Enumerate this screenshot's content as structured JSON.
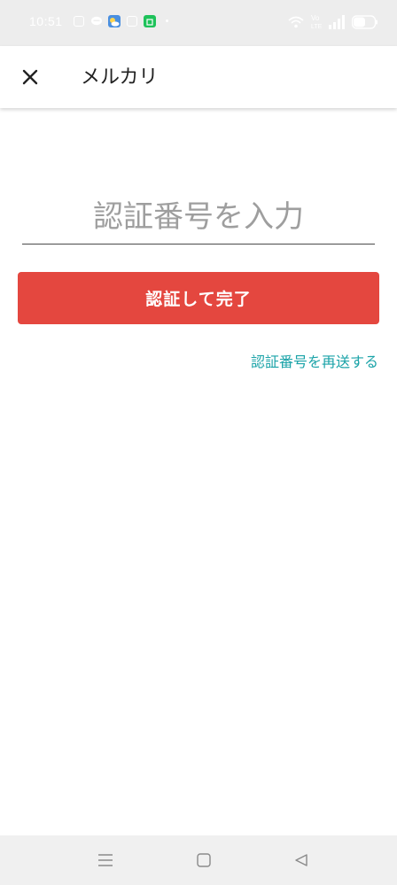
{
  "status_bar": {
    "time": "10:51",
    "icons": [
      "instagram-icon",
      "chat-icon",
      "weather-icon",
      "instagram-icon",
      "calendar-icon",
      "wifi-icon",
      "volte-icon",
      "signal-icon",
      "battery-icon"
    ],
    "volte_label": "Vo LTE"
  },
  "app_bar": {
    "close_icon": "close-icon",
    "title": "メルカリ"
  },
  "form": {
    "code_placeholder": "認証番号を入力",
    "code_value": "",
    "submit_label": "認証して完了",
    "resend_label": "認証番号を再送する"
  },
  "colors": {
    "primary": "#e4473f",
    "link": "#1aa3a8",
    "placeholder": "#9e9e9e",
    "status_bar_bg": "#ededed",
    "nav_bar_bg": "#f0f0f0"
  },
  "nav_bar": {
    "icons": [
      "menu-icon",
      "home-icon",
      "back-icon"
    ]
  }
}
